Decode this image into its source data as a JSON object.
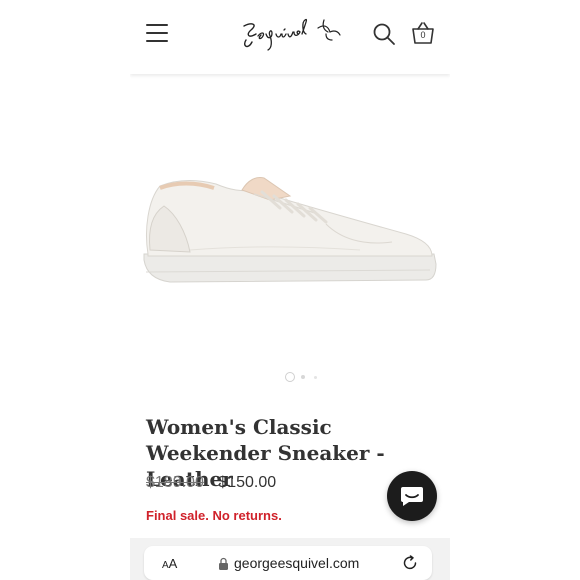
{
  "header": {
    "logo_text": "Esquivel",
    "cart_count": "0"
  },
  "product": {
    "title": "Women's Classic Weekender Sneaker - Leather",
    "compare_price": "$189.00",
    "price": "$150.00",
    "notice": "Final sale. No returns.",
    "image_count": 3,
    "active_image": 1
  },
  "browser": {
    "text_size_label_big": "A",
    "text_size_label_small": "A",
    "url": "georgeesquivel.com"
  },
  "colors": {
    "accent_red": "#d0222b",
    "chat_button": "#1c1c1c"
  },
  "icons": [
    "menu-icon",
    "search-icon",
    "basket-icon",
    "chat-icon",
    "lock-icon",
    "reload-icon"
  ]
}
